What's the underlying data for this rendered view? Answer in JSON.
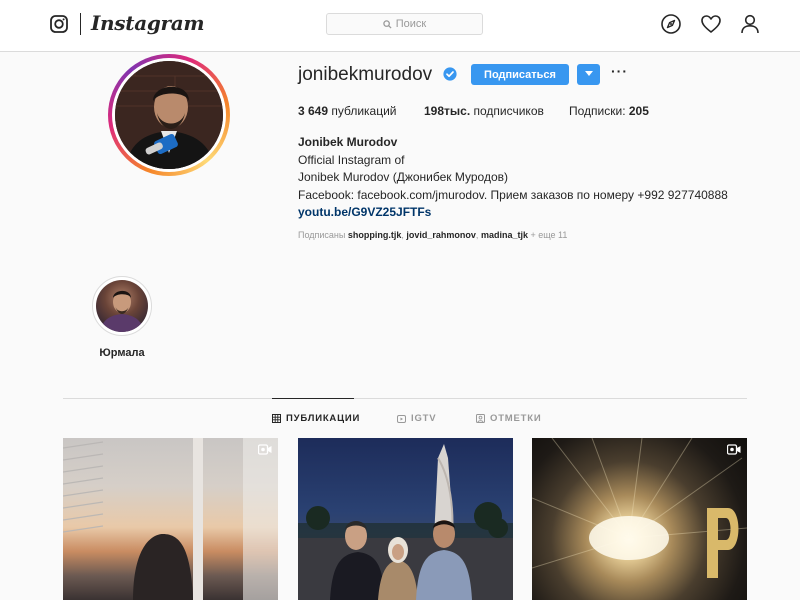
{
  "nav": {
    "brand": "Instagram",
    "search_placeholder": "Поиск",
    "icons": [
      "instagram-glyph-icon",
      "search-icon",
      "explore-compass-icon",
      "heart-icon",
      "profile-icon"
    ]
  },
  "profile": {
    "username": "jonibekmurodov",
    "verified": true,
    "follow_label": "Подписаться",
    "more_label": "···",
    "stats": {
      "posts_value": "3 649",
      "posts_label": "публикаций",
      "followers_value": "198тыс.",
      "followers_label": "подписчиков",
      "following_label": "Подписки:",
      "following_value": "205"
    },
    "bio": {
      "full_name": "Jonibek Murodov",
      "line1": "Official Instagram of",
      "line2": "Jonibek Murodov (Джонибек Муродов)",
      "line3": "Facebook: facebook.com/jmurodov. Прием заказов по номеру +992 927740888",
      "link": "youtu.be/G9VZ25JFTFs"
    },
    "followed_by": {
      "prefix": "Подписаны",
      "user1": "shopping.tjk",
      "user2": "jovid_rahmonov",
      "user3": "madina_tjk",
      "suffix": "+ еще 11"
    }
  },
  "highlights": [
    {
      "label": "Юрмала"
    }
  ],
  "tabs": [
    {
      "label": "ПУБЛИКАЦИИ",
      "active": true,
      "icon": "grid-icon"
    },
    {
      "label": "IGTV",
      "active": false,
      "icon": "igtv-icon"
    },
    {
      "label": "ОТМЕТКИ",
      "active": false,
      "icon": "tagged-icon"
    }
  ],
  "colors": {
    "accent": "#3897f0",
    "link": "#003569",
    "border": "#dbdbdb",
    "muted": "#999999"
  }
}
